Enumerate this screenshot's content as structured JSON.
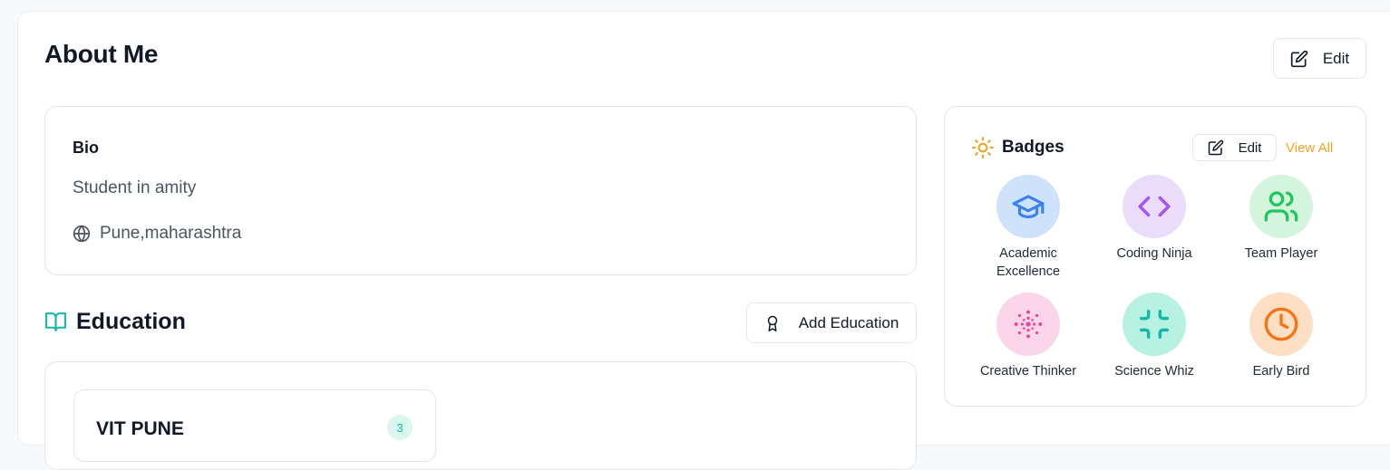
{
  "header": {
    "title": "About Me",
    "edit_label": "Edit"
  },
  "bio": {
    "label": "Bio",
    "text": "Student in amity",
    "location": "Pune,maharashtra"
  },
  "education": {
    "title": "Education",
    "add_label": "Add Education",
    "institutions": [
      {
        "name": "VIT PUNE",
        "count": "3"
      }
    ]
  },
  "badges": {
    "title": "Badges",
    "edit_label": "Edit",
    "view_all_label": "View All",
    "items": [
      {
        "label": "Academic Excellence",
        "icon": "graduation-cap-icon",
        "bg": "#cfe2fb",
        "color": "#3b82f6"
      },
      {
        "label": "Coding Ninja",
        "icon": "code-icon",
        "bg": "#eadcfb",
        "color": "#a855f7"
      },
      {
        "label": "Team Player",
        "icon": "users-icon",
        "bg": "#d3f5de",
        "color": "#22c55e"
      },
      {
        "label": "Creative Thinker",
        "icon": "sparkle-icon",
        "bg": "#fbd6e8",
        "color": "#ec4899"
      },
      {
        "label": "Science Whiz",
        "icon": "minimize-icon",
        "bg": "#b7f1e2",
        "color": "#14b8a6"
      },
      {
        "label": "Early Bird",
        "icon": "clock-icon",
        "bg": "#fde0c4",
        "color": "#f97316"
      }
    ]
  },
  "colors": {
    "accent_orange": "#f5a524",
    "accent_teal": "#14b8a6",
    "text_dark": "#111827",
    "text_muted": "#4b5563",
    "border": "#e3e5ea"
  }
}
